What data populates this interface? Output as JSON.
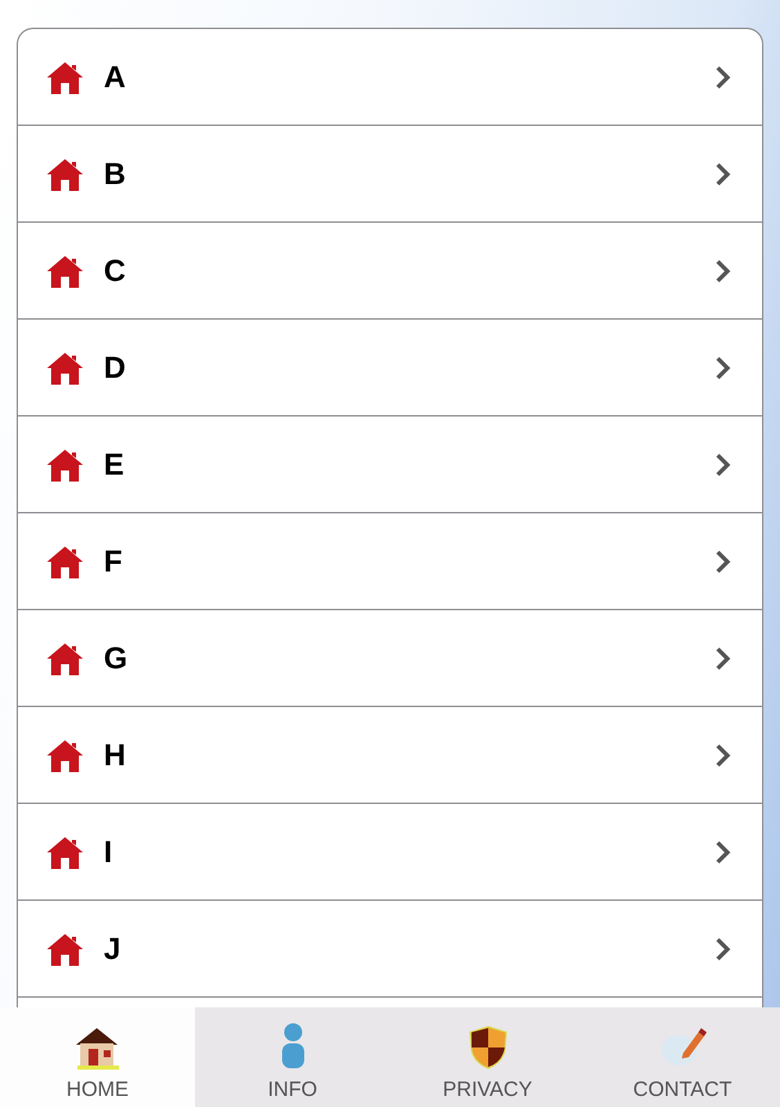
{
  "list": {
    "items": [
      {
        "label": "A"
      },
      {
        "label": "B"
      },
      {
        "label": "C"
      },
      {
        "label": "D"
      },
      {
        "label": "E"
      },
      {
        "label": "F"
      },
      {
        "label": "G"
      },
      {
        "label": "H"
      },
      {
        "label": "I"
      },
      {
        "label": "J"
      }
    ]
  },
  "tab_bar": {
    "tabs": [
      {
        "label": "HOME",
        "kind": "home",
        "selected": true
      },
      {
        "label": "INFO",
        "kind": "info",
        "selected": false
      },
      {
        "label": "PRIVACY",
        "kind": "privacy",
        "selected": false
      },
      {
        "label": "CONTACT",
        "kind": "contact",
        "selected": false
      }
    ]
  }
}
